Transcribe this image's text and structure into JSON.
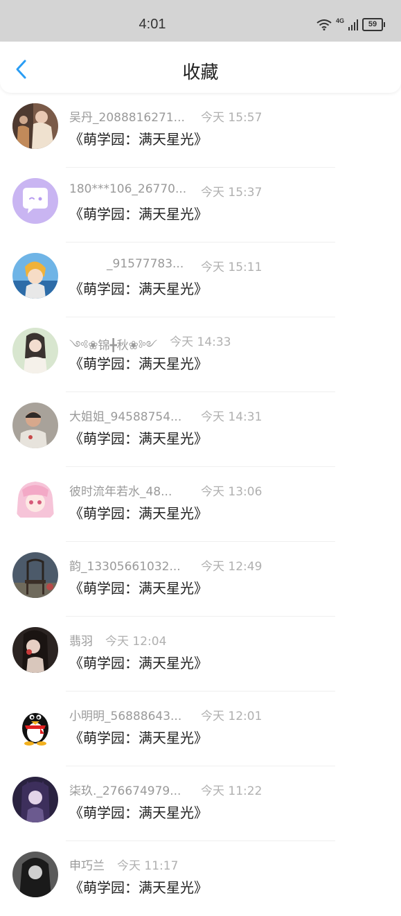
{
  "status_bar": {
    "time": "4:01",
    "network": "4G",
    "battery": "59"
  },
  "header": {
    "title": "收藏"
  },
  "items": [
    {
      "name": "吴丹_2088816271...",
      "time": "今天 15:57",
      "message": "《萌学园：满天星光》"
    },
    {
      "name": "180***106_26770...",
      "time": "今天 15:37",
      "message": "《萌学园：满天星光》"
    },
    {
      "name": "_91577783...",
      "time": "今天 15:11",
      "message": "《萌学园：满天星光》"
    },
    {
      "name": "༺❀锦╋秋❀༻",
      "time": "今天 14:33",
      "message": "《萌学园：满天星光》"
    },
    {
      "name": "大姐姐_94588754...",
      "time": "今天 14:31",
      "message": "《萌学园：满天星光》"
    },
    {
      "name": "彼时流年若水_48...",
      "time": "今天 13:06",
      "message": "《萌学园：满天星光》"
    },
    {
      "name": "韵_13305661032...",
      "time": "今天 12:49",
      "message": "《萌学园：满天星光》"
    },
    {
      "name": "翡羽",
      "time": "今天 12:04",
      "message": "《萌学园：满天星光》"
    },
    {
      "name": "小明明_56888643...",
      "time": "今天 12:01",
      "message": "《萌学园：满天星光》"
    },
    {
      "name": "柒玖._276674979...",
      "time": "今天 11:22",
      "message": "《萌学园：满天星光》"
    },
    {
      "name": "申巧兰",
      "time": "今天 11:17",
      "message": "《萌学园：满天星光》"
    }
  ],
  "colors": {
    "accent": "#2a9df4",
    "status_bar_bg": "#d4d4d4",
    "meta_text": "#9a9a9a",
    "message_text": "#222222"
  }
}
